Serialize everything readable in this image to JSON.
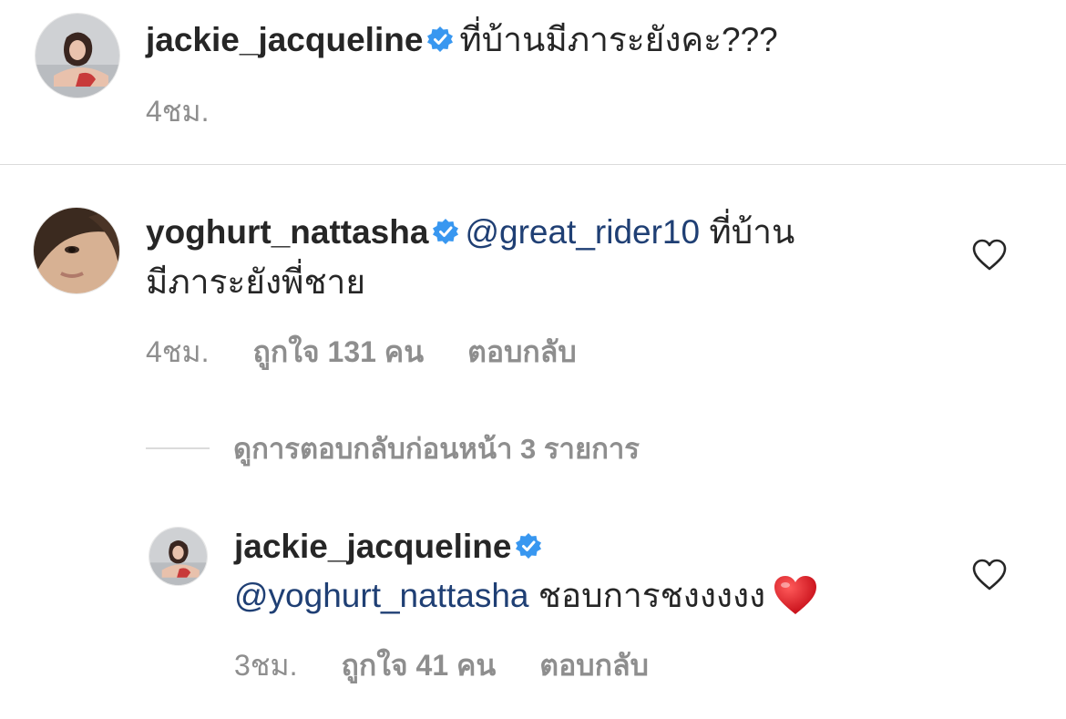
{
  "caption": {
    "username": "jackie_jacqueline",
    "text": "ที่บ้านมีภาระยังคะ???",
    "time": "4ชม."
  },
  "comment": {
    "username": "yoghurt_nattasha",
    "mention": "@great_rider10",
    "text_line1": "ที่บ้าน",
    "text_line2": "มีภาระยังพี่ชาย",
    "time": "4ชม.",
    "likes": "ถูกใจ 131 คน",
    "reply": "ตอบกลับ"
  },
  "view_replies": "ดูการตอบกลับก่อนหน้า 3 รายการ",
  "reply": {
    "username": "jackie_jacqueline",
    "mention": "@yoghurt_nattasha",
    "text": "ชอบการชงงงงง",
    "time": "3ชม.",
    "likes": "ถูกใจ 41 คน",
    "reply": "ตอบกลับ"
  },
  "icons": {
    "verified": "verified-badge-icon",
    "like": "heart-outline-icon",
    "emoji": "red-heart-emoji"
  },
  "colors": {
    "verified": "#3897f0",
    "mention": "#1f3f74",
    "secondary_text": "#8e8e8e",
    "divider": "#dbdbdb",
    "emoji_heart": "#e0141e"
  }
}
